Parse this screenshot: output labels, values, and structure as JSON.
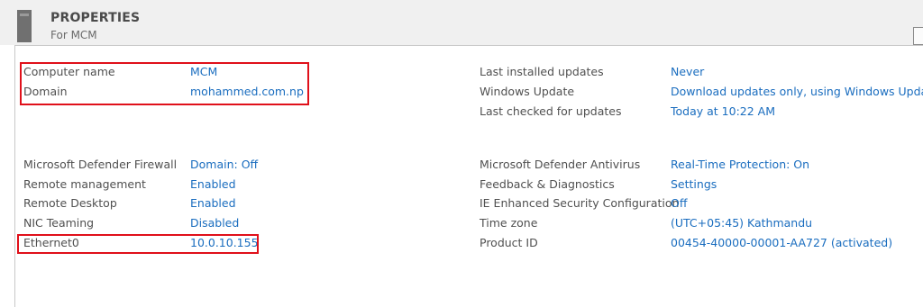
{
  "header": {
    "title": "PROPERTIES",
    "subtitle": "For MCM"
  },
  "properties_left_top": [
    {
      "label": "Computer name",
      "value": "MCM"
    },
    {
      "label": "Domain",
      "value": "mohammed.com.np"
    }
  ],
  "properties_right_top": [
    {
      "label": "Last installed updates",
      "value": "Never"
    },
    {
      "label": "Windows Update",
      "value": "Download updates only, using Windows Update"
    },
    {
      "label": "Last checked for updates",
      "value": "Today at 10:22 AM"
    }
  ],
  "properties_left_bottom": [
    {
      "label": "Microsoft Defender Firewall",
      "value": "Domain: Off"
    },
    {
      "label": "Remote management",
      "value": "Enabled"
    },
    {
      "label": "Remote Desktop",
      "value": "Enabled"
    },
    {
      "label": "NIC Teaming",
      "value": "Disabled"
    },
    {
      "label": "Ethernet0",
      "value": "10.0.10.155"
    }
  ],
  "properties_right_bottom": [
    {
      "label": "Microsoft Defender Antivirus",
      "value": "Real-Time Protection: On"
    },
    {
      "label": "Feedback & Diagnostics",
      "value": "Settings"
    },
    {
      "label": "IE Enhanced Security Configuration",
      "value": "Off"
    },
    {
      "label": "Time zone",
      "value": "(UTC+05:45) Kathmandu"
    },
    {
      "label": "Product ID",
      "value": "00454-40000-00001-AA727 (activated)"
    }
  ],
  "colors": {
    "link": "#1a6dbf",
    "label": "#505050",
    "highlight": "#e0101a",
    "header_bg": "#f0f0f0"
  }
}
